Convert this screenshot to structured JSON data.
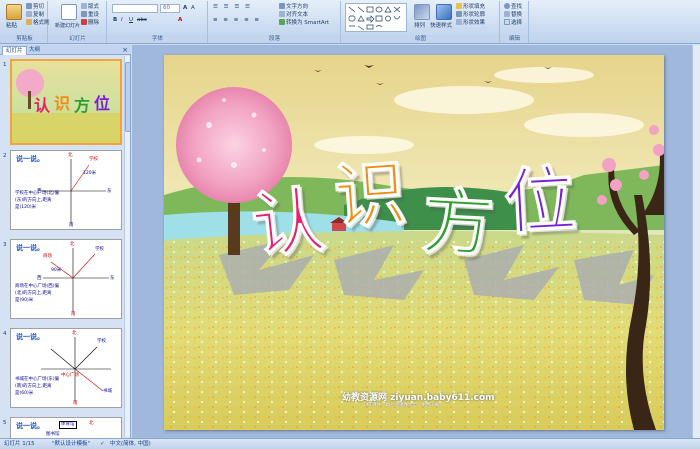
{
  "ribbon": {
    "clipboard": {
      "paste": "粘贴",
      "cut": "剪切",
      "copy": "复制",
      "format_painter": "格式刷",
      "label": "剪贴板"
    },
    "slides": {
      "new_slide": "新建幻灯片",
      "layout": "版式",
      "reset": "重设",
      "delete": "删除",
      "label": "幻灯片"
    },
    "font": {
      "font_size": "60",
      "label": "字体"
    },
    "paragraph": {
      "text_direction": "文字方向",
      "align_text": "对齐文本",
      "smartart": "转换为 SmartArt",
      "label": "段落"
    },
    "drawing": {
      "arrange": "排列",
      "quick_styles": "快速样式",
      "shape_fill": "形状填充",
      "shape_outline": "形状轮廓",
      "shape_effects": "形状效果",
      "label": "绘图"
    },
    "editing": {
      "find": "查找",
      "replace": "替换",
      "select": "选择",
      "label": "编辑"
    }
  },
  "left_pane": {
    "tab_slides": "幻灯片",
    "tab_outline": "大纲",
    "close": "×",
    "thumbs": [
      {
        "num": "1"
      },
      {
        "num": "2",
        "title": "说一说。",
        "lines": [
          "学校在中心广场(北)偏",
          "(东)的方向上,距离",
          "是(120)米"
        ],
        "labels": [
          "北",
          "学校",
          "120米",
          "西",
          "东",
          "南"
        ]
      },
      {
        "num": "3",
        "title": "说一说。",
        "lines": [
          "商场在中心广场(西)偏",
          "(北)的方向上,距离",
          "是(90)米"
        ],
        "labels": [
          "北",
          "商场",
          "90米",
          "学校",
          "西",
          "东",
          "南"
        ]
      },
      {
        "num": "4",
        "title": "说一说。",
        "lines": [
          "书城在中心广场(东)偏",
          "(南)的方向上,距离",
          "是(60)米"
        ],
        "labels": [
          "北",
          "学校",
          "中心广场",
          "书城",
          "南"
        ]
      },
      {
        "num": "5",
        "title": "说一说。",
        "labels": [
          "体育馆",
          "北",
          "图书馆"
        ]
      }
    ]
  },
  "slide": {
    "title_chars": [
      "认",
      "识",
      "方",
      "位"
    ],
    "watermark": "幼教资源网 ziyuan.baby611.com",
    "watermark_sub": "PPT课件 · 幼儿园课件大全 · 免费下载"
  },
  "status_bar": {
    "slide_count": "幻灯片 1/15",
    "theme": "\"默认设计模板\"",
    "language": "中文(简体, 中国)"
  },
  "colors": {
    "ribbon_bg": "#dbe6f5",
    "accent": "#15428b",
    "title_red": "#e8206a",
    "title_orange": "#f28c10",
    "title_green": "#2f9e2f",
    "title_purple": "#7a1fd6",
    "selection": "#f2a33a"
  }
}
